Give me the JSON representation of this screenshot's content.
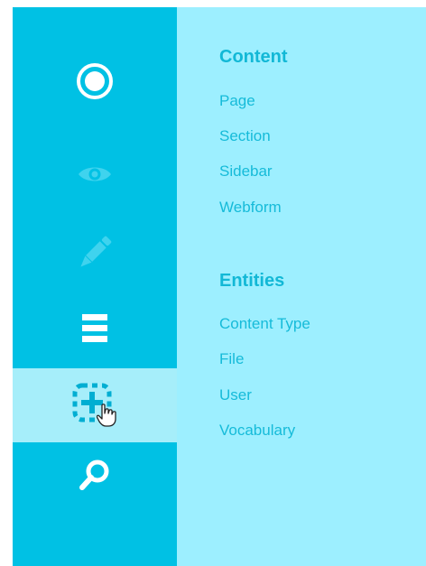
{
  "sidebar": {
    "items": [
      {
        "name": "record-icon",
        "active": false
      },
      {
        "name": "eye-icon",
        "active": false
      },
      {
        "name": "pencil-icon",
        "active": false
      },
      {
        "name": "menu-icon",
        "active": false
      },
      {
        "name": "add-box-icon",
        "active": true
      },
      {
        "name": "search-icon",
        "active": false
      }
    ]
  },
  "panel": {
    "content": {
      "heading": "Content",
      "items": [
        "Page",
        "Section",
        "Sidebar",
        "Webform"
      ]
    },
    "entities": {
      "heading": "Entities",
      "items": [
        "Content Type",
        "File",
        "User",
        "Vocabulary"
      ]
    }
  },
  "colors": {
    "sidebar_bg": "#00c1e4",
    "sidebar_active": "#a6eefa",
    "panel_bg": "#9defff",
    "text_accent": "#12b8d6"
  }
}
